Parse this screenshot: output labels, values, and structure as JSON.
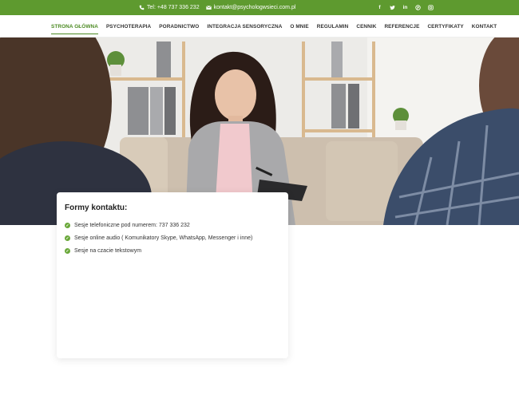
{
  "topbar": {
    "phone": "Tel: +48 737 336 232",
    "email": "kontakt@psychologwsieci.com.pl",
    "socials": [
      "facebook-icon",
      "twitter-icon",
      "linkedin-icon",
      "pinterest-icon",
      "instagram-icon"
    ],
    "background": "#5e9a2f"
  },
  "nav": {
    "items": [
      {
        "label": "STRONA GŁÓWNA",
        "active": true
      },
      {
        "label": "PSYCHOTERAPIA"
      },
      {
        "label": "PORADNICTWO"
      },
      {
        "label": "INTEGRACJA SENSORYCZNA"
      },
      {
        "label": "O MNIE"
      },
      {
        "label": "REGULAMIN"
      },
      {
        "label": "CENNIK"
      },
      {
        "label": "REFERENCJE"
      },
      {
        "label": "CERTYFIKATY"
      },
      {
        "label": "KONTAKT"
      }
    ],
    "accent": "#4b8a22"
  },
  "card": {
    "title": "Formy kontaktu:",
    "items": [
      "Sesje telefoniczne pod numerem: 737 336 232",
      "Sesje online audio ( Komunikatory Skype, WhatsApp, Messenger i inne)",
      "Sesje na czacie tekstowym"
    ]
  }
}
